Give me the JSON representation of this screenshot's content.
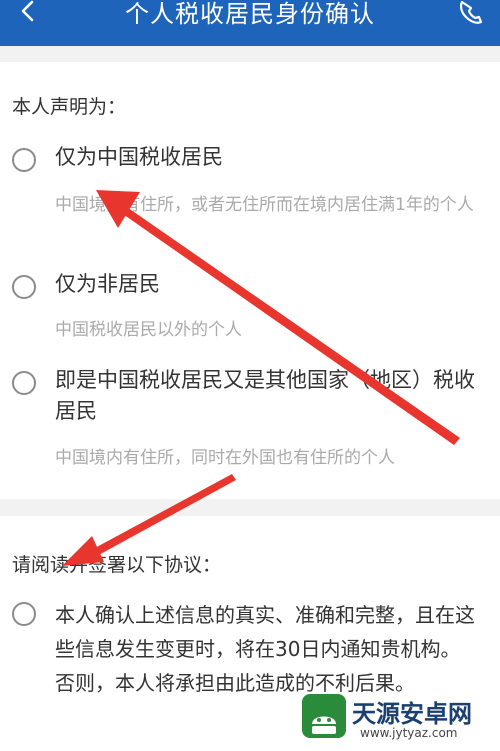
{
  "header": {
    "title": "个人税收居民身份确认",
    "back_icon": "chevron-left-icon",
    "phone_icon": "phone-icon"
  },
  "declaration": {
    "title": "本人声明为：",
    "options": [
      {
        "label": "仅为中国税收居民",
        "desc": "中国境内有住所，或者无住所而在境内居住满1年的个人"
      },
      {
        "label": "仅为非居民",
        "desc": "中国税收居民以外的个人"
      },
      {
        "label": "即是中国税收居民又是其他国家（地区）税收居民",
        "desc": "中国境内有住所，同时在外国也有住所的个人"
      }
    ]
  },
  "agreement": {
    "title": "请阅读并签署以下协议：",
    "text": "本人确认上述信息的真实、准确和完整，且在这些信息发生变更时，将在30日内通知贵机构。否则，本人将承担由此造成的不利后果。"
  },
  "watermark": {
    "title": "天源安卓网",
    "url": "www.jytyaz.com"
  },
  "colors": {
    "header_bg": "#1f64bb",
    "arrow": "#e8362f",
    "page_bg": "#f2f2f2"
  }
}
